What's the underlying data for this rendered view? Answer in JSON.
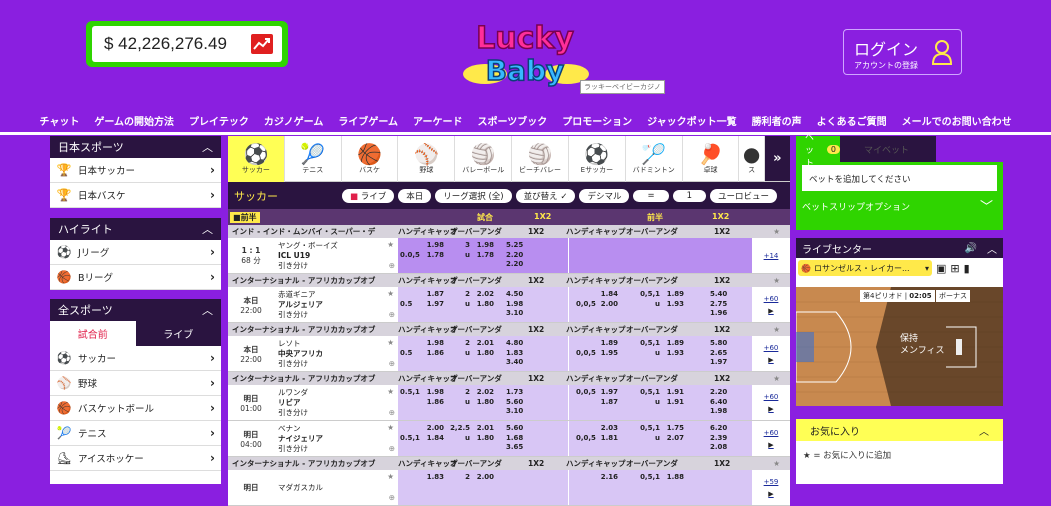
{
  "header": {
    "balance": "$ 42,226,276.49",
    "logo_line1": "Lucky",
    "logo_line2": "Baby",
    "logo_sub": "ラッキーベイビーカジノ",
    "login_title": "ログイン",
    "login_sub": "アカウントの登録"
  },
  "nav": [
    "チャット",
    "ゲームの開始方法",
    "プレイテック",
    "カジノゲーム",
    "ライブゲーム",
    "アーケード",
    "スポーツブック",
    "プロモーション",
    "ジャックポット一覧",
    "勝利者の声",
    "よくあるご質問",
    "メールでのお問い合わせ"
  ],
  "sidebar": {
    "japan": {
      "title": "日本スポーツ",
      "items": [
        {
          "label": "日本サッカー",
          "icon": "trophy-icon"
        },
        {
          "label": "日本バスケ",
          "icon": "trophy-icon"
        }
      ]
    },
    "highlight": {
      "title": "ハイライト",
      "items": [
        {
          "label": "Jリーグ",
          "icon": "soccer-ball-icon"
        },
        {
          "label": "Bリーグ",
          "icon": "basketball-icon"
        }
      ]
    },
    "all": {
      "title": "全スポーツ",
      "tab_prematch": "試合前",
      "tab_live": "ライブ",
      "items": [
        {
          "label": "サッカー",
          "icon": "soccer-ball-icon"
        },
        {
          "label": "野球",
          "icon": "baseball-icon"
        },
        {
          "label": "バスケットボール",
          "icon": "basketball-icon"
        },
        {
          "label": "テニス",
          "icon": "tennis-icon"
        },
        {
          "label": "アイスホッケー",
          "icon": "skate-icon"
        }
      ]
    }
  },
  "sport_tabs": [
    {
      "label": "サッカー",
      "icon": "soccer-ball-icon",
      "symbol": "⚽"
    },
    {
      "label": "テニス",
      "icon": "tennis-racket-icon",
      "symbol": "🎾"
    },
    {
      "label": "バスケ",
      "icon": "basketball-icon",
      "symbol": "🏀"
    },
    {
      "label": "野球",
      "icon": "baseball-icon",
      "symbol": "⚾"
    },
    {
      "label": "バレーボール",
      "icon": "volleyball-icon",
      "symbol": "🏐"
    },
    {
      "label": "ビーチバレー",
      "icon": "beach-volleyball-icon",
      "symbol": "🏐"
    },
    {
      "label": "Eサッカー",
      "icon": "esoccer-icon",
      "symbol": "⚽"
    },
    {
      "label": "バドミントン",
      "icon": "shuttlecock-icon",
      "symbol": "🏸"
    },
    {
      "label": "卓球",
      "icon": "table-tennis-icon",
      "symbol": "🏓"
    },
    {
      "label": "ス",
      "icon": "other-sport-icon",
      "symbol": "●"
    }
  ],
  "filter": {
    "title": "サッカー",
    "live": "ライブ",
    "today": "本日",
    "league": "リーグ選択 (全)",
    "sort": "並び替え",
    "decimal": "デシマル",
    "eq": "=",
    "one": "1",
    "euro": "ユーロビュー"
  },
  "col_head": {
    "prematch": "前半",
    "match": "試合",
    "x12": "1X2",
    "half": "前半",
    "x12b": "1X2"
  },
  "market_labels": {
    "handicap": "ハンディキャップ",
    "overunder": "オーバーアンダ",
    "x12": "1X2"
  },
  "events": [
    {
      "league": "インド - インド・ムンバイ・スーパー・デ",
      "time1": "1 : 1",
      "time2": "68 分",
      "team1": "ヤング・ボーイズ",
      "team2": "ICL U19",
      "draw": "引き分け",
      "h1": [
        "",
        "0.0,5"
      ],
      "h1o": [
        "1.98",
        "1.78"
      ],
      "ou1": [
        "3",
        "u"
      ],
      "ou1o": [
        "1.98",
        "1.78"
      ],
      "x1": [
        "5.25",
        "2.20",
        "2.20"
      ],
      "h2": [
        "",
        ""
      ],
      "h2o": [
        "",
        ""
      ],
      "ou2": [
        "",
        ""
      ],
      "ou2o": [
        "",
        ""
      ],
      "x2": [
        "",
        "",
        ""
      ],
      "side": "+14",
      "highlight": true
    },
    {
      "league": "インターナショナル - アフリカカップオブ",
      "time1": "本日",
      "time2": "22:00",
      "team1": "赤道ギニア",
      "team2": "アルジェリア",
      "draw": "引き分け",
      "h1": [
        "",
        "0.5"
      ],
      "h1o": [
        "1.87",
        "1.97"
      ],
      "ou1": [
        "2",
        "u"
      ],
      "ou1o": [
        "2.02",
        "1.80"
      ],
      "x1": [
        "4.50",
        "1.98",
        "3.10"
      ],
      "h2": [
        "",
        "0,0,5"
      ],
      "h2o": [
        "1.84",
        "2.00"
      ],
      "ou2": [
        "0,5,1",
        "u"
      ],
      "ou2o": [
        "1.89",
        "1.93"
      ],
      "x2": [
        "5.40",
        "2.75",
        "1.96"
      ],
      "side": "+60",
      "highlight": false
    },
    {
      "league": "インターナショナル - アフリカカップオブ",
      "time1": "本日",
      "time2": "22:00",
      "team1": "レソト",
      "team2": "中央アフリカ",
      "draw": "引き分け",
      "h1": [
        "",
        "0.5"
      ],
      "h1o": [
        "1.98",
        "1.86"
      ],
      "ou1": [
        "2",
        "u"
      ],
      "ou1o": [
        "2.01",
        "1.80"
      ],
      "x1": [
        "4.80",
        "1.83",
        "3.40"
      ],
      "h2": [
        "",
        "0,0,5"
      ],
      "h2o": [
        "1.89",
        "1.95"
      ],
      "ou2": [
        "0,5,1",
        "u"
      ],
      "ou2o": [
        "1.89",
        "1.93"
      ],
      "x2": [
        "5.80",
        "2.65",
        "1.97"
      ],
      "side": "+60",
      "highlight": false
    },
    {
      "league": "インターナショナル - アフリカカップオブ",
      "time1": "明日",
      "time2": "01:00",
      "team1": "ルワンダ",
      "team2": "リビア",
      "draw": "引き分け",
      "h1": [
        "0.5,1",
        ""
      ],
      "h1o": [
        "1.98",
        "1.86"
      ],
      "ou1": [
        "2",
        "u"
      ],
      "ou1o": [
        "2.02",
        "1.80"
      ],
      "x1": [
        "1.73",
        "5.60",
        "3.10"
      ],
      "h2": [
        "0,0,5",
        ""
      ],
      "h2o": [
        "1.97",
        "1.87"
      ],
      "ou2": [
        "0,5,1",
        "u"
      ],
      "ou2o": [
        "1.91",
        "1.91"
      ],
      "x2": [
        "2.20",
        "6.40",
        "1.98"
      ],
      "side": "+60",
      "highlight": false
    },
    {
      "league": "",
      "time1": "明日",
      "time2": "04:00",
      "team1": "ベナン",
      "team2": "ナイジェリア",
      "draw": "引き分け",
      "h1": [
        "",
        "0.5,1"
      ],
      "h1o": [
        "2.00",
        "1.84"
      ],
      "ou1": [
        "2,2.5",
        "u"
      ],
      "ou1o": [
        "2.01",
        "1.80"
      ],
      "x1": [
        "5.60",
        "1.68",
        "3.65"
      ],
      "h2": [
        "",
        "0,0,5"
      ],
      "h2o": [
        "2.03",
        "1.81"
      ],
      "ou2": [
        "0,5,1",
        "u"
      ],
      "ou2o": [
        "1.75",
        "2.07"
      ],
      "x2": [
        "6.20",
        "2.39",
        "2.08"
      ],
      "side": "+60",
      "highlight": false
    },
    {
      "league": "インターナショナル - アフリカカップオブ",
      "time1": "明日",
      "time2": "",
      "team1": "マダガスカル",
      "team2": "",
      "draw": "",
      "h1": [
        "",
        ""
      ],
      "h1o": [
        "1.83",
        ""
      ],
      "ou1": [
        "2",
        ""
      ],
      "ou1o": [
        "2.00",
        ""
      ],
      "x1": [
        "",
        ""
      ],
      "h2": [
        "",
        ""
      ],
      "h2o": [
        "2.16",
        ""
      ],
      "ou2": [
        "0,5,1",
        ""
      ],
      "ou2o": [
        "1.88",
        ""
      ],
      "x2": [
        "",
        ""
      ],
      "side": "+59",
      "highlight": false
    }
  ],
  "betslip": {
    "tab1": "ベット",
    "badge": "0",
    "tab2": "マイベット",
    "placeholder": "ベットを追加してください",
    "options": "ベットスリップオプション"
  },
  "live": {
    "title": "ライブセンター",
    "match": "ロサンゼルス・レイカー...",
    "period": "第4ピリオド",
    "clock": "02:05",
    "bonus": "ボーナス",
    "team": "保持",
    "team2": "メンフィス"
  },
  "favorites": {
    "title": "お気に入り",
    "hint": "★ = お気に入りに追加"
  },
  "colors": {
    "accent": "#8a1fe0",
    "dark": "#2a1440",
    "green": "#2fd400",
    "yellow": "#ffe94a"
  }
}
